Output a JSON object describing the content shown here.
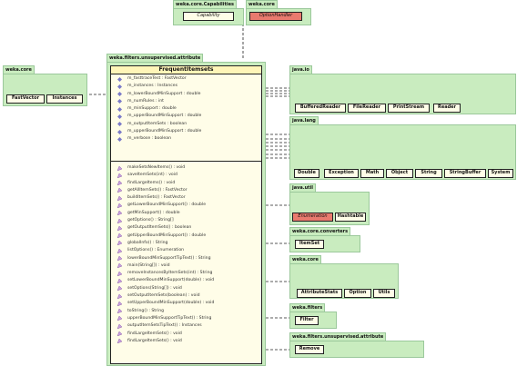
{
  "colors": {
    "package_bg": "#c9ecbf",
    "class_bg": "#fffde8",
    "interface_red": "#e97a6e",
    "field_icon": "#7a7ac8",
    "method_icon": "#c8a0e0"
  },
  "packages": {
    "weka_core_capabilities": {
      "label": "weka.core.Capabilities",
      "classes": [
        "Capability"
      ]
    },
    "weka_core_top": {
      "label": "weka.core",
      "classes": [
        "OptionHandler"
      ]
    },
    "weka_core_left": {
      "label": "weka.core",
      "classes": [
        "FastVector",
        "Instances"
      ]
    },
    "main_pkg": {
      "label": "weka.filters.unsupervised.attribute"
    },
    "java_io": {
      "label": "java.io",
      "classes": [
        "BufferedReader",
        "FileReader",
        "PrintStream",
        "Reader"
      ]
    },
    "java_lang": {
      "label": "java.lang",
      "classes": [
        "Double",
        "Exception",
        "Math",
        "Object",
        "String",
        "StringBuffer",
        "System"
      ]
    },
    "java_util": {
      "label": "java.util",
      "classes": [
        "Enumeration",
        "Hashtable"
      ]
    },
    "weka_core_converters": {
      "label": "weka.core.converters",
      "classes": [
        "ItemSet"
      ]
    },
    "weka_core_mid": {
      "label": "weka.core",
      "classes": [
        "AttributeStats",
        "Option",
        "Utils"
      ]
    },
    "weka_filters": {
      "label": "weka.filters",
      "classes": [
        "Filter"
      ]
    },
    "weka_filters_unsup": {
      "label": "weka.filters.unsupervised.attribute",
      "classes": [
        "Remove"
      ]
    }
  },
  "main_class": {
    "name": "FrequentItemsets",
    "fields": [
      "m_fasttraceTest : FastVector",
      "m_instances : Instances",
      "m_lowerBoundMinSupport : double",
      "m_numRules : int",
      "m_minSupport : double",
      "m_upperBoundMinSupport : double",
      "m_outputItemSets : boolean",
      "m_upperBoundMinSupport : double",
      "m_verbose : boolean"
    ],
    "methods": [
      "makeSetsNewItems() : void",
      "saveItemSets(int) : void",
      "findLargeItems() : void",
      "getAllItemSets() : FastVector",
      "buildItemSets() : FastVector",
      "getLowerBoundMinSupport() : double",
      "getMinSupport() : double",
      "getOptions() : String[]",
      "getOutputItemSets() : boolean",
      "getUpperBoundMinSupport() : double",
      "globalInfo() : String",
      "listOptions() : Enumeration",
      "lowerBoundMinSupportTipText() : String",
      "main(String[]) : void",
      "removeInstancesByItemSets(int) : String",
      "setLowerBoundMinSupport(double) : void",
      "setOptions(String[]) : void",
      "setOutputItemSets(boolean) : void",
      "setUpperBoundMinSupport(double) : void",
      "toString() : String",
      "upperBoundMinSupportTipText() : String",
      "outputItemSetsTipText() : Instances",
      "findLargeItemSets() : void",
      "findLargeItemSets() : void"
    ]
  }
}
